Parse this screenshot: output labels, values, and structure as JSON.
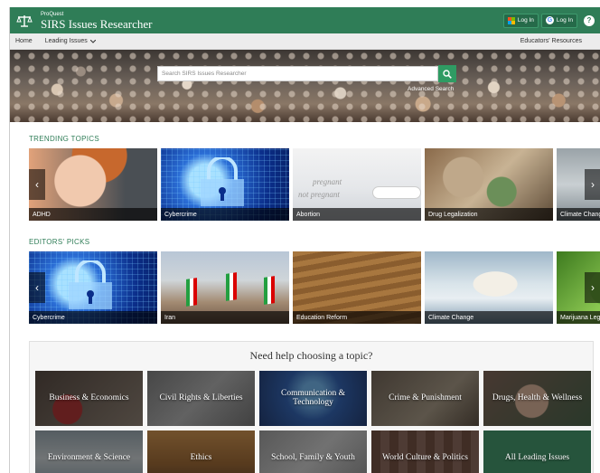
{
  "header": {
    "brand_small": "ProQuest",
    "brand_title": "SIRS Issues Researcher",
    "login_ms": "Log In",
    "login_google": "Log In",
    "help": "?"
  },
  "nav": {
    "home": "Home",
    "leading_issues": "Leading Issues",
    "educators": "Educators' Resources"
  },
  "hero": {
    "search_placeholder": "Search SIRS Issues Researcher",
    "advanced_search": "Advanced Search"
  },
  "trending": {
    "title": "TRENDING TOPICS",
    "cards": [
      {
        "label": "ADHD"
      },
      {
        "label": "Cybercrime"
      },
      {
        "label": "Abortion"
      },
      {
        "label": "Drug Legalization"
      },
      {
        "label": "Climate Change"
      }
    ]
  },
  "editors": {
    "title": "EDITORS' PICKS",
    "cards": [
      {
        "label": "Cybercrime"
      },
      {
        "label": "Iran"
      },
      {
        "label": "Education Reform"
      },
      {
        "label": "Climate Change"
      },
      {
        "label": "Marijuana Legalization"
      }
    ]
  },
  "abortion_image_text": {
    "line1": "pregnant",
    "line2": "not pregnant"
  },
  "help_panel": {
    "title": "Need help choosing a topic?",
    "topics": [
      {
        "label": "Business & Economics"
      },
      {
        "label": "Civil Rights & Liberties"
      },
      {
        "label": "Communication & Technology"
      },
      {
        "label": "Crime & Punishment"
      },
      {
        "label": "Drugs, Health & Wellness"
      },
      {
        "label": "Environment & Science"
      },
      {
        "label": "Ethics"
      },
      {
        "label": "School, Family & Youth"
      },
      {
        "label": "World Culture & Politics"
      },
      {
        "label": "All Leading Issues"
      }
    ]
  },
  "colors": {
    "brand_green": "#2f7d57",
    "search_button": "#2f9b63"
  }
}
